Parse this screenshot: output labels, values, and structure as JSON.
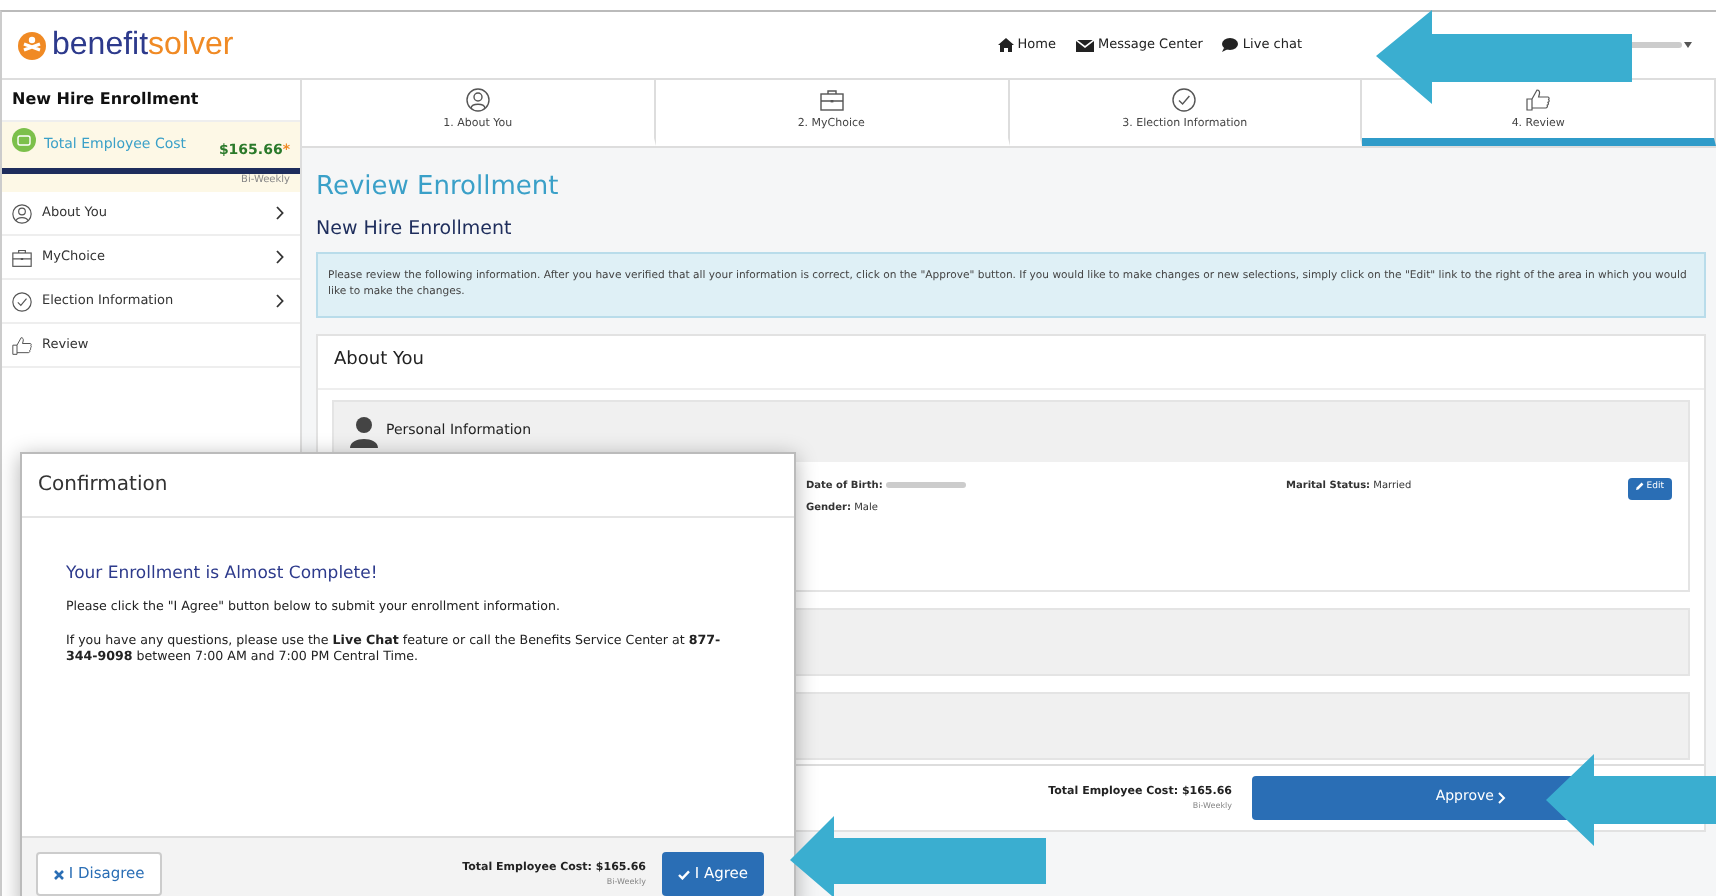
{
  "header": {
    "logo_main": "benefit",
    "logo_accent": "solver",
    "nav": [
      {
        "label": "Home",
        "kind": "home"
      },
      {
        "label": "Message Center",
        "kind": "envelope"
      },
      {
        "label": "Live chat",
        "kind": "chat"
      }
    ]
  },
  "sidebar": {
    "title": "New Hire Enrollment",
    "cost_label": "Total Employee Cost",
    "cost_amount": "$165.66",
    "cost_mark": "*",
    "cost_frequency": "Bi-Weekly",
    "items": [
      {
        "label": "About You",
        "kind": "person",
        "chevron": true
      },
      {
        "label": "MyChoice",
        "kind": "briefcase",
        "chevron": true
      },
      {
        "label": "Election Information",
        "kind": "check",
        "chevron": true
      },
      {
        "label": "Review",
        "kind": "thumb",
        "chevron": false
      }
    ]
  },
  "steps": [
    {
      "label": "1. About You",
      "kind": "person",
      "selected": false
    },
    {
      "label": "2. MyChoice",
      "kind": "briefcase",
      "selected": false
    },
    {
      "label": "3. Election Information",
      "kind": "check",
      "selected": false
    },
    {
      "label": "4. Review",
      "kind": "thumb",
      "selected": true
    }
  ],
  "main": {
    "title": "Review Enrollment",
    "subtitle": "New Hire Enrollment",
    "notice": "Please review the following information. After you have verified that all your information is correct, click on the \"Approve\" button. If you would like to make changes or new selections, simply click on the \"Edit\" link to the right of the area in which you would like to make the changes.",
    "section_title": "About You",
    "panel": {
      "title": "Personal Information",
      "edit": "Edit",
      "fields": [
        {
          "label": "Date of Birth:",
          "redacted": true
        },
        {
          "label": "Gender:",
          "value": "Male",
          "redacted": false
        },
        {
          "label": "Marital Status:",
          "value": "Married",
          "redacted": false
        }
      ]
    }
  },
  "footer": {
    "cost": "Total Employee Cost: $165.66",
    "frequency": "Bi-Weekly",
    "approve": "Approve"
  },
  "modal": {
    "title": "Confirmation",
    "heading": "Your Enrollment is Almost Complete!",
    "paragraphs": [
      "Please click the \"I Agree\" button below to submit your enrollment information.",
      "If you have any questions, please use the **Live Chat** feature or call the Benefits Service Center at **877-344-9098** between 7:00 AM and 7:00 PM Central Time."
    ],
    "cost": "Total Employee Cost: $165.66",
    "frequency": "Bi-Weekly",
    "disagree": "I Disagree",
    "agree": "I Agree"
  }
}
